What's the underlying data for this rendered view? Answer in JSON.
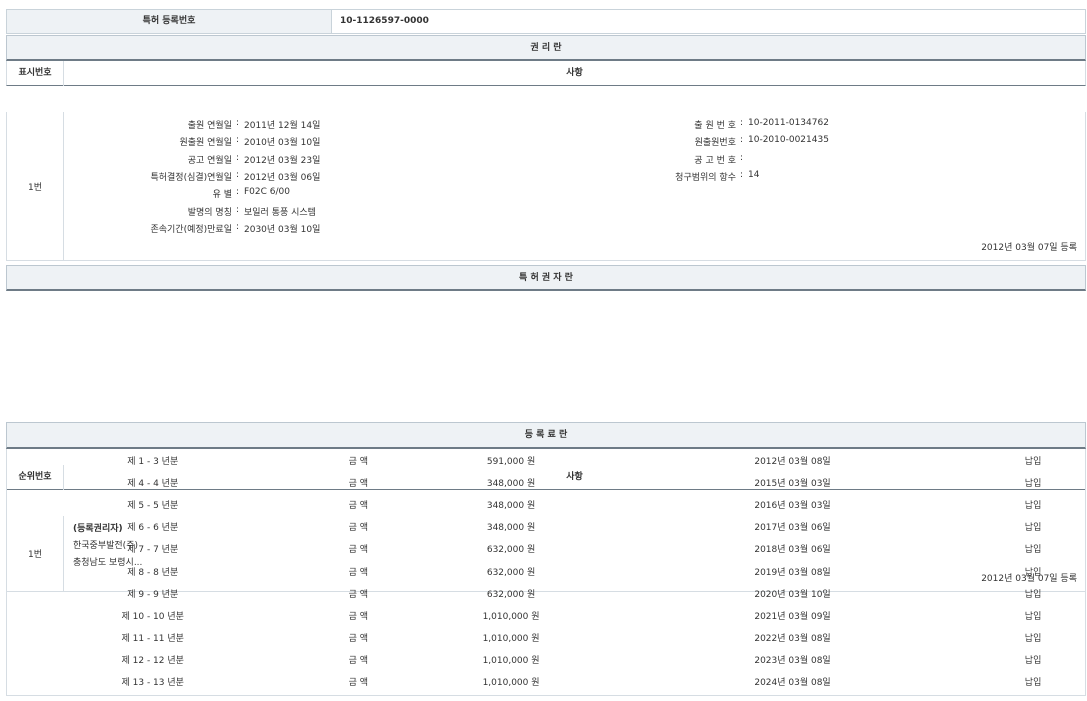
{
  "top": {
    "label": "특허 등록번호",
    "value": "10-1126597-0000"
  },
  "rights": {
    "title": "권 리 란",
    "col_num": "표시번호",
    "col_desc": "사항",
    "row_num": "1번",
    "left": [
      {
        "label": "출원 연월일",
        "value": "2011년 12월 14일"
      },
      {
        "label": "원출원 연월일",
        "value": "2010년 03월 10일"
      },
      {
        "label": "공고 연월일",
        "value": "2012년 03월 23일"
      },
      {
        "label": "특허결정(심결)연월일",
        "value": "2012년 03월 06일"
      },
      {
        "label": "유 별",
        "value": "F02C 6/00"
      },
      {
        "label": "발명의 명칭",
        "value": "보일러 통풍 시스템"
      },
      {
        "label": "존속기간(예정)만료일",
        "value": "2030년 03월 10일"
      }
    ],
    "right": [
      {
        "label": "출 원 번 호",
        "value": "10-2011-0134762"
      },
      {
        "label": "원출원번호",
        "value": "10-2010-0021435"
      },
      {
        "label": "공 고 번 호",
        "value": ""
      },
      {
        "label": "청구범위의 항수",
        "value": "14"
      }
    ],
    "registered": "2012년 03월 07일 등록"
  },
  "owner": {
    "title": "특 허 권 자 란",
    "col_num": "순위번호",
    "col_desc": "사항",
    "row_num": "1번",
    "lines": [
      "(등록권리자)",
      "한국중부발전(주)",
      "충청남도 보령시..."
    ],
    "registered": "2012년 03월 07일 등록"
  },
  "fees": {
    "title": "등 록 료 란",
    "rows": [
      {
        "period": "제 1 - 3 년분",
        "label": "금 액",
        "amount": "591,000 원",
        "date": "2012년 03월 08일",
        "status": "납입"
      },
      {
        "period": "제 4 - 4 년분",
        "label": "금 액",
        "amount": "348,000 원",
        "date": "2015년 03월 03일",
        "status": "납입"
      },
      {
        "period": "제 5 - 5 년분",
        "label": "금 액",
        "amount": "348,000 원",
        "date": "2016년 03월 03일",
        "status": "납입"
      },
      {
        "period": "제 6 - 6 년분",
        "label": "금 액",
        "amount": "348,000 원",
        "date": "2017년 03월 06일",
        "status": "납입"
      },
      {
        "period": "제 7 - 7 년분",
        "label": "금 액",
        "amount": "632,000 원",
        "date": "2018년 03월 06일",
        "status": "납입"
      },
      {
        "period": "제 8 - 8 년분",
        "label": "금 액",
        "amount": "632,000 원",
        "date": "2019년 03월 08일",
        "status": "납입"
      },
      {
        "period": "제 9 - 9 년분",
        "label": "금 액",
        "amount": "632,000 원",
        "date": "2020년 03월 10일",
        "status": "납입"
      },
      {
        "period": "제 10 - 10 년분",
        "label": "금 액",
        "amount": "1,010,000 원",
        "date": "2021년 03월 09일",
        "status": "납입"
      },
      {
        "period": "제 11 - 11 년분",
        "label": "금 액",
        "amount": "1,010,000 원",
        "date": "2022년 03월 08일",
        "status": "납입"
      },
      {
        "period": "제 12 - 12 년분",
        "label": "금 액",
        "amount": "1,010,000 원",
        "date": "2023년 03월 08일",
        "status": "납입"
      },
      {
        "period": "제 13 - 13 년분",
        "label": "금 액",
        "amount": "1,010,000 원",
        "date": "2024년 03월 08일",
        "status": "납입"
      }
    ]
  }
}
